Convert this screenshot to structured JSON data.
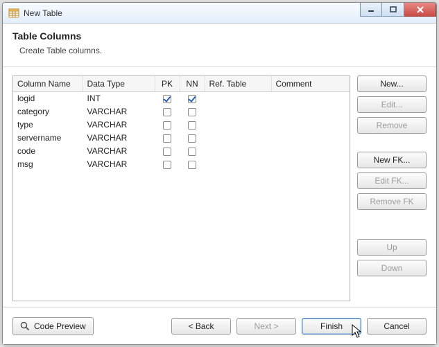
{
  "window": {
    "title": "New Table"
  },
  "header": {
    "title": "Table Columns",
    "subtitle": "Create Table columns."
  },
  "table": {
    "headers": {
      "col_name": "Column Name",
      "data_type": "Data Type",
      "pk": "PK",
      "nn": "NN",
      "ref_table": "Ref. Table",
      "comment": "Comment"
    },
    "rows": [
      {
        "name": "logid",
        "type": "INT",
        "pk": true,
        "nn": true,
        "ref": "",
        "comment": ""
      },
      {
        "name": "category",
        "type": "VARCHAR",
        "pk": false,
        "nn": false,
        "ref": "",
        "comment": ""
      },
      {
        "name": "type",
        "type": "VARCHAR",
        "pk": false,
        "nn": false,
        "ref": "",
        "comment": ""
      },
      {
        "name": "servername",
        "type": "VARCHAR",
        "pk": false,
        "nn": false,
        "ref": "",
        "comment": ""
      },
      {
        "name": "code",
        "type": "VARCHAR",
        "pk": false,
        "nn": false,
        "ref": "",
        "comment": ""
      },
      {
        "name": "msg",
        "type": "VARCHAR",
        "pk": false,
        "nn": false,
        "ref": "",
        "comment": ""
      }
    ]
  },
  "side_buttons": {
    "new": "New...",
    "edit": "Edit...",
    "remove": "Remove",
    "new_fk": "New FK...",
    "edit_fk": "Edit FK...",
    "remove_fk": "Remove FK",
    "up": "Up",
    "down": "Down"
  },
  "footer": {
    "code_preview": "Code Preview",
    "back": "< Back",
    "next": "Next >",
    "finish": "Finish",
    "cancel": "Cancel"
  }
}
